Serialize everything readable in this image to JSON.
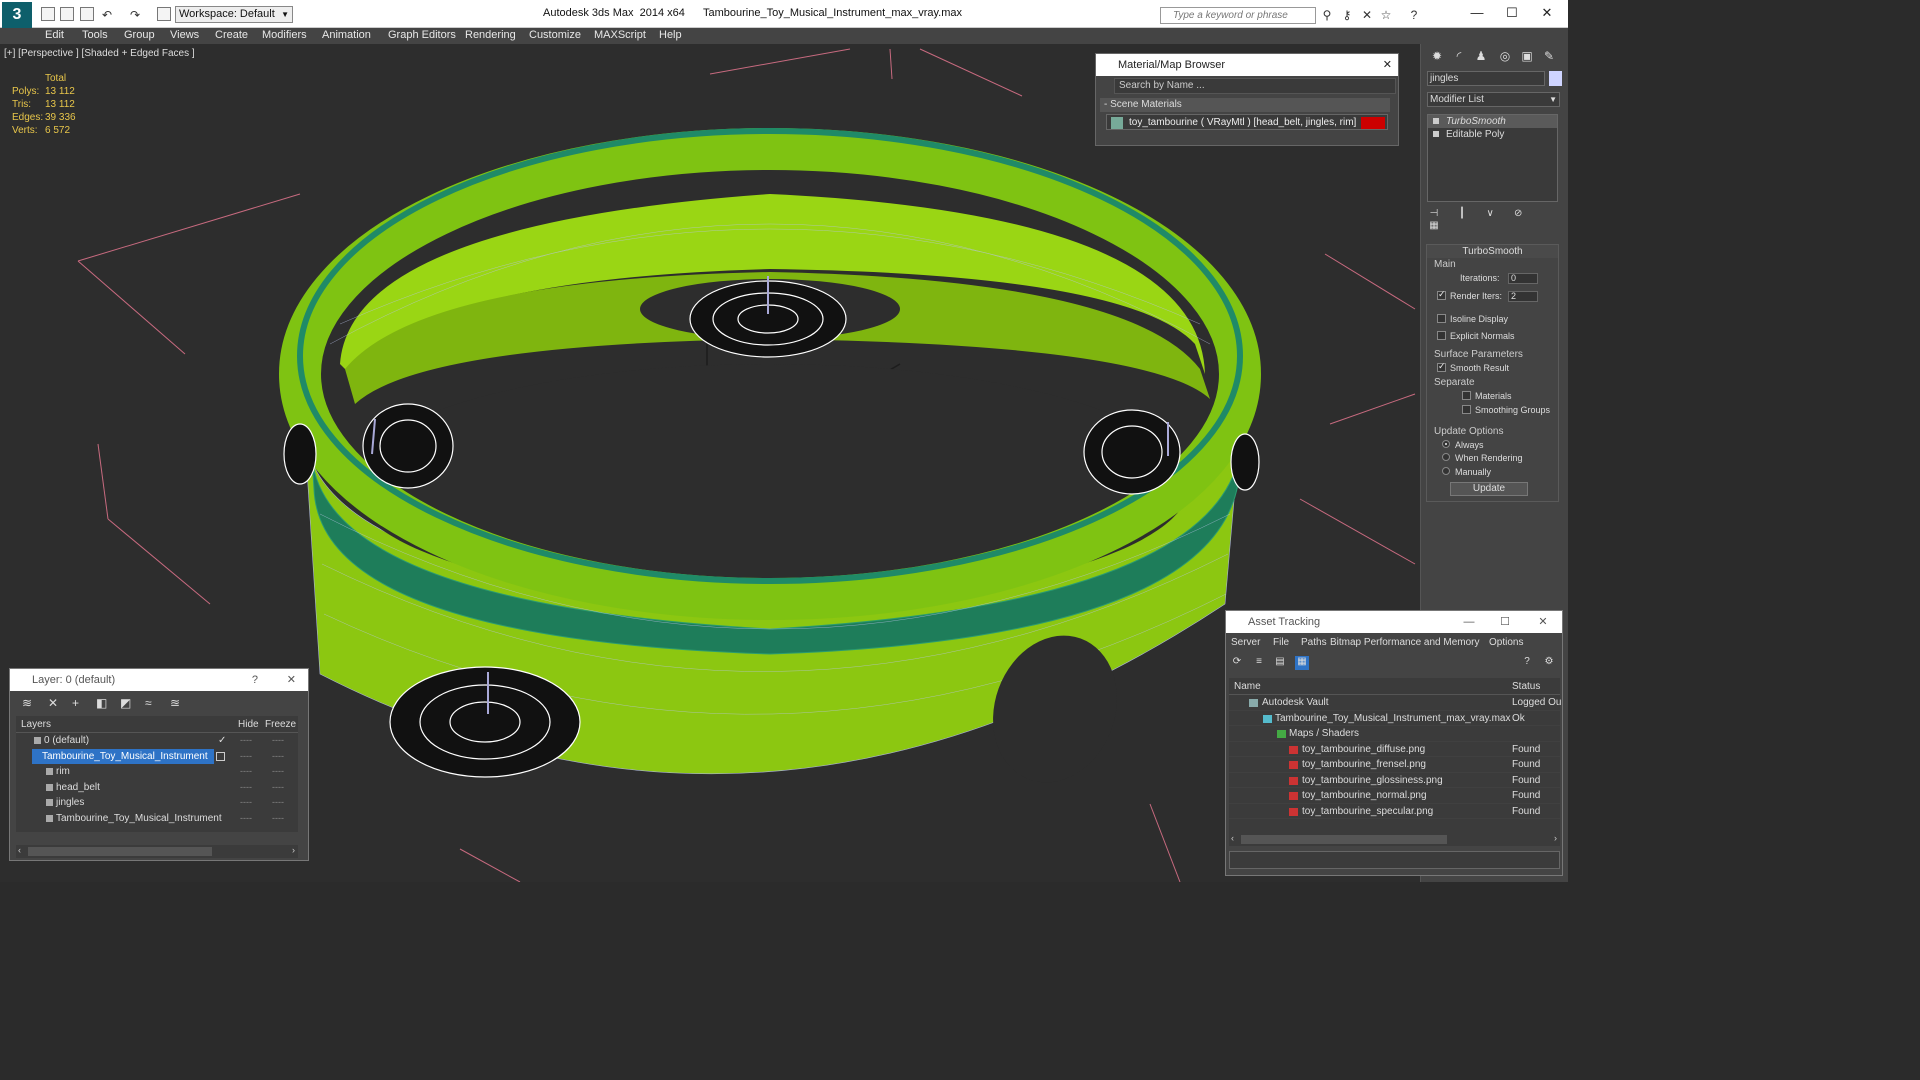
{
  "app": {
    "logo_text": "3",
    "title": "Autodesk 3ds Max  2014 x64      Tambourine_Toy_Musical_Instrument_max_vray.max",
    "workspace": "Workspace: Default",
    "search_placeholder": "Type a keyword or phrase"
  },
  "menu": [
    "Edit",
    "Tools",
    "Group",
    "Views",
    "Create",
    "Modifiers",
    "Animation",
    "Graph Editors",
    "Rendering",
    "Customize",
    "MAXScript",
    "Help"
  ],
  "viewport": {
    "label": "[+] [Perspective ] [Shaded + Edged Faces ]",
    "stats": {
      "header": "Total",
      "polys_label": "Polys:",
      "polys": "13 112",
      "tris_label": "Tris:",
      "tris": "13 112",
      "edges_label": "Edges:",
      "edges": "39 336",
      "verts_label": "Verts:",
      "verts": "6 572"
    },
    "colors": {
      "shell": "#8fcc10",
      "belt": "#1e7d5a",
      "wire": "#ffffff",
      "background": "#2d2d2d"
    }
  },
  "material_browser": {
    "title": "Material/Map Browser",
    "search": "Search by Name ...",
    "section": "- Scene Materials",
    "item": "toy_tambourine  ( VRayMtl ) [head_belt, jingles, rim]"
  },
  "command_panel": {
    "object_name": "jingles",
    "modifier_list": "Modifier List",
    "stack": [
      "TurboSmooth",
      "Editable Poly"
    ],
    "rollout_title": "TurboSmooth",
    "main_label": "Main",
    "iterations_label": "Iterations:",
    "iterations": "0",
    "render_iters_label": "Render Iters:",
    "render_iters": "2",
    "isoline": "Isoline Display",
    "explicit_normals": "Explicit Normals",
    "surface_params": "Surface Parameters",
    "smooth_result": "Smooth Result",
    "separate": "Separate",
    "materials": "Materials",
    "smoothing_groups": "Smoothing Groups",
    "update_options": "Update Options",
    "always": "Always",
    "when_rendering": "When Rendering",
    "manually": "Manually",
    "update_button": "Update"
  },
  "layer_window": {
    "title": "Layer: 0 (default)",
    "help": "?",
    "col_layers": "Layers",
    "col_hide": "Hide",
    "col_freeze": "Freeze",
    "rows": [
      "0 (default)",
      "Tambourine_Toy_Musical_Instrument",
      "rim",
      "head_belt",
      "jingles",
      "Tambourine_Toy_Musical_Instrument"
    ],
    "dash": "----"
  },
  "asset_window": {
    "title": "Asset Tracking",
    "menu": [
      "Server",
      "File",
      "Paths",
      "Bitmap Performance and Memory",
      "Options"
    ],
    "col_name": "Name",
    "col_status": "Status",
    "rows": [
      {
        "name": "Autodesk Vault",
        "status": "Logged Ou"
      },
      {
        "name": "Tambourine_Toy_Musical_Instrument_max_vray.max",
        "status": "Ok"
      },
      {
        "name": "Maps / Shaders",
        "status": ""
      },
      {
        "name": "toy_tambourine_diffuse.png",
        "status": "Found"
      },
      {
        "name": "toy_tambourine_frensel.png",
        "status": "Found"
      },
      {
        "name": "toy_tambourine_glossiness.png",
        "status": "Found"
      },
      {
        "name": "toy_tambourine_normal.png",
        "status": "Found"
      },
      {
        "name": "toy_tambourine_specular.png",
        "status": "Found"
      }
    ]
  }
}
